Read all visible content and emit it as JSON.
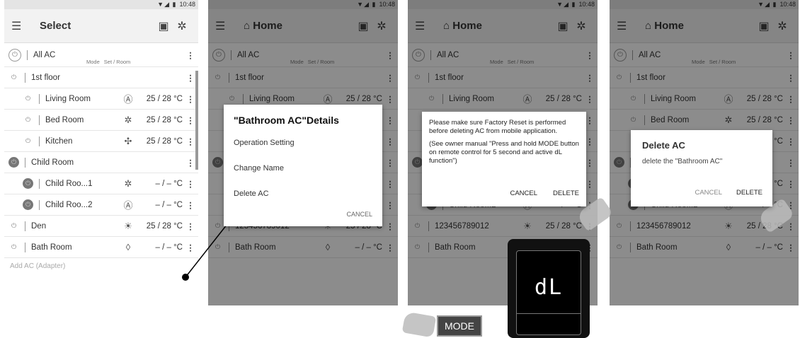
{
  "status": {
    "time": "10:48",
    "icons": "▼◢ ▮"
  },
  "panel1": {
    "title": "Select",
    "rows": [
      {
        "name": "All AC",
        "mode": "",
        "temp": "",
        "type": "header"
      },
      {
        "name": "1st floor",
        "mode": "",
        "temp": "",
        "type": "group"
      },
      {
        "name": "Living Room",
        "mode": "Ⓐ",
        "temp": "25 / 28 °C",
        "type": "item"
      },
      {
        "name": "Bed Room",
        "mode": "✲",
        "temp": "25 / 28 °C",
        "type": "item"
      },
      {
        "name": "Kitchen",
        "mode": "✣",
        "temp": "25 / 28 °C",
        "type": "item"
      },
      {
        "name": "Child Room",
        "mode": "",
        "temp": "",
        "type": "group-dark"
      },
      {
        "name": "Child Roo...1",
        "mode": "✲",
        "temp": "– / –  °C",
        "type": "item-dark"
      },
      {
        "name": "Child Roo...2",
        "mode": "Ⓐ",
        "temp": "– / –  °C",
        "type": "item-dark"
      },
      {
        "name": "Den",
        "mode": "☀",
        "temp": "25 / 28 °C",
        "type": "group"
      },
      {
        "name": "Bath Room",
        "mode": "◊",
        "temp": "– / –  °C",
        "type": "group"
      }
    ],
    "subheader": {
      "mode": "Mode",
      "set": "Set / Room"
    },
    "footer": "Add AC (Adapter)"
  },
  "home_panel": {
    "title": "Home",
    "rows": [
      {
        "name": "All AC",
        "mode": "",
        "temp": ""
      },
      {
        "name": "1st floor",
        "mode": "",
        "temp": ""
      },
      {
        "name": "Living Room",
        "mode": "Ⓐ",
        "temp": "25 / 28 °C"
      },
      {
        "name": "Bed Room",
        "mode": "✲",
        "temp": "25 / 28 °C"
      },
      {
        "name": "Kitchen",
        "mode": "✣",
        "temp": "25 / 28 °C"
      },
      {
        "name": "Child Room",
        "mode": "",
        "temp": ""
      },
      {
        "name": "Child Roo...1",
        "mode": "✲",
        "temp": "– / –  °C"
      },
      {
        "name": "Child Roo...2",
        "mode": "Ⓐ",
        "temp": "– / –  °C"
      },
      {
        "name": "123456789012",
        "mode": "☀",
        "temp": "25 / 28 °C"
      },
      {
        "name": "Bath Room",
        "mode": "◊",
        "temp": "– / –  °C"
      }
    ]
  },
  "dialog_details": {
    "title": "\"Bathroom  AC\"Details",
    "items": [
      "Operation Setting",
      "Change Name",
      "Delete AC"
    ],
    "cancel": "CANCEL"
  },
  "dialog_warning": {
    "p1": "Please make sure Factory Reset is performed before deleting AC from mobile application.",
    "p2": "(See owner manual \"Press and hold MODE button on remote control for 5 second and active dL function\")",
    "cancel": "CANCEL",
    "delete": "DELETE"
  },
  "dialog_delete": {
    "title": "Delete AC",
    "message": "delete the \"Bathroom AC\"",
    "cancel": "CANCEL",
    "delete": "DELETE"
  },
  "remote": {
    "display": "dL",
    "button": "MODE"
  }
}
